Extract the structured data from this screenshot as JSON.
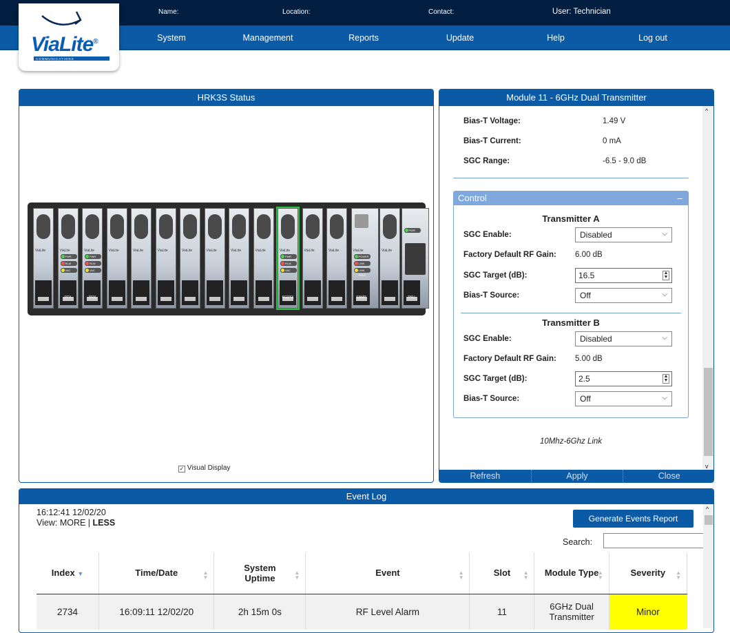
{
  "header": {
    "name_label": "Name:",
    "location_label": "Location:",
    "contact_label": "Contact:",
    "user_label": "User: Technician"
  },
  "logo": {
    "text": "ViaLite",
    "reg": "®",
    "sub": "COMMUNICATIONS"
  },
  "nav": [
    "System",
    "Management",
    "Reports",
    "Update",
    "Help",
    "Log out"
  ],
  "status_panel": {
    "title": "HRK3S Status",
    "visual_display_label": "Visual Display",
    "visual_display_checked": true,
    "slots": [
      {
        "name": "",
        "label": "ViaLite"
      },
      {
        "name": "DTX",
        "label": "ViaLite",
        "leds": [
          "FWR",
          "RLM",
          "VAC"
        ]
      },
      {
        "name": "DRX",
        "label": "ViaLite",
        "leds": [
          "FWR",
          "RLM",
          "VAC"
        ]
      },
      {
        "name": "",
        "label": "ViaLite"
      },
      {
        "name": "",
        "label": "ViaLite"
      },
      {
        "name": "",
        "label": "ViaLite"
      },
      {
        "name": "",
        "label": "ViaLite"
      },
      {
        "name": "",
        "label": "ViaLite"
      },
      {
        "name": "",
        "label": "ViaLite"
      },
      {
        "name": "",
        "label": "ViaLite"
      },
      {
        "name": "6GDTX",
        "label": "ViaLite",
        "leds": [
          "FWR",
          "RLM",
          "VAC"
        ],
        "selected": true
      },
      {
        "name": "",
        "label": "ViaLite"
      },
      {
        "name": "",
        "label": "ViaLite"
      },
      {
        "name": "SNMP",
        "label": "ViaLite",
        "leds": [
          "POWER",
          "LINK REAR",
          "LINK FRNT"
        ]
      },
      {
        "name": "",
        "label": "ViaLite"
      },
      {
        "name": "PSU",
        "label": "",
        "leds": [
          "PWR"
        ]
      }
    ]
  },
  "module_panel": {
    "title": "Module 11 - 6GHz Dual Transmitter",
    "info": [
      {
        "label": "Bias-T Voltage:",
        "value": "1.49 V"
      },
      {
        "label": "Bias-T Current:",
        "value": "0 mA"
      },
      {
        "label": "SGC Range:",
        "value": "-6.5 - 9.0 dB"
      }
    ],
    "control_title": "Control",
    "control_minimize": "–",
    "transmitter_a": {
      "title": "Transmitter A",
      "sgc_enable_label": "SGC Enable:",
      "sgc_enable_value": "Disabled",
      "factory_gain_label": "Factory Default RF Gain:",
      "factory_gain_value": "6.00 dB",
      "sgc_target_label": "SGC Target (dB):",
      "sgc_target_value": "16.5",
      "bias_source_label": "Bias-T Source:",
      "bias_source_value": "Off"
    },
    "transmitter_b": {
      "title": "Transmitter B",
      "sgc_enable_label": "SGC Enable:",
      "sgc_enable_value": "Disabled",
      "factory_gain_label": "Factory Default RF Gain:",
      "factory_gain_value": "5.00 dB",
      "sgc_target_label": "SGC Target (dB):",
      "sgc_target_value": "2.5",
      "bias_source_label": "Bias-T Source:",
      "bias_source_value": "Off"
    },
    "footer_note": "10Mhz-6Ghz Link",
    "buttons": [
      "Refresh",
      "Apply",
      "Close"
    ]
  },
  "event_log": {
    "title": "Event Log",
    "timestamp": "16:12:41 12/02/20",
    "view_prefix": "View: ",
    "view_more": "MORE",
    "view_sep": " | ",
    "view_less": "LESS",
    "generate_button": "Generate Events Report",
    "search_label": "Search:",
    "search_value": "",
    "columns": [
      "Index",
      "Time/Date",
      "System Uptime",
      "Event",
      "Slot",
      "Module Type",
      "Severity"
    ],
    "rows": [
      {
        "index": "2734",
        "time": "16:09:11 12/02/20",
        "uptime": "2h 15m 0s",
        "event": "RF Level Alarm",
        "slot": "11",
        "module_type": "6GHz Dual Transmitter",
        "severity": "Minor"
      }
    ]
  },
  "colors": {
    "brand_blue": "#0b5aa6",
    "top_bar": "#011e41",
    "severity_minor": "#ffff00"
  }
}
